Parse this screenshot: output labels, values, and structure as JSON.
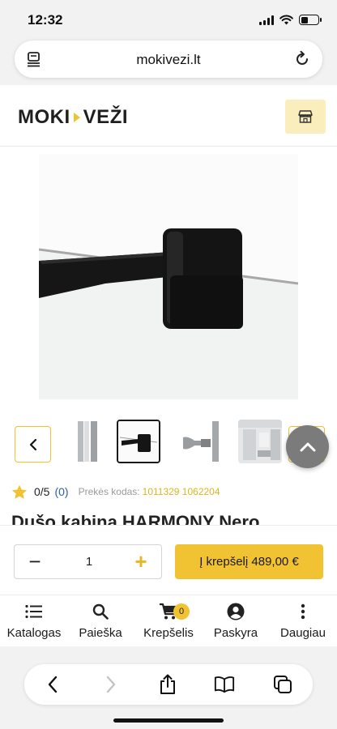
{
  "status_bar": {
    "time": "12:32"
  },
  "browser": {
    "url": "mokivezi.lt"
  },
  "site": {
    "logo_left": "MOKI",
    "logo_right": "VEŽI"
  },
  "product": {
    "rating_score": "0/5",
    "rating_count": "(0)",
    "sku_label": "Prekės kodas:",
    "sku_value": "1011329 1062204",
    "title": "Dušo kabina HARMONY Nero"
  },
  "cart": {
    "quantity": "1",
    "minus_label": "−",
    "plus_label": "+",
    "add_label": "Į krepšelį 489,00 €"
  },
  "nav": {
    "items": [
      {
        "label": "Katalogas",
        "icon": "list-icon"
      },
      {
        "label": "Paieška",
        "icon": "search-icon"
      },
      {
        "label": "Krepšelis",
        "icon": "cart-icon",
        "badge": "0"
      },
      {
        "label": "Paskyra",
        "icon": "user-icon"
      },
      {
        "label": "Daugiau",
        "icon": "more-icon"
      }
    ]
  },
  "colors": {
    "accent": "#f1c232",
    "accent_light": "#f9eebc",
    "link_blue": "#2a5fa8"
  }
}
